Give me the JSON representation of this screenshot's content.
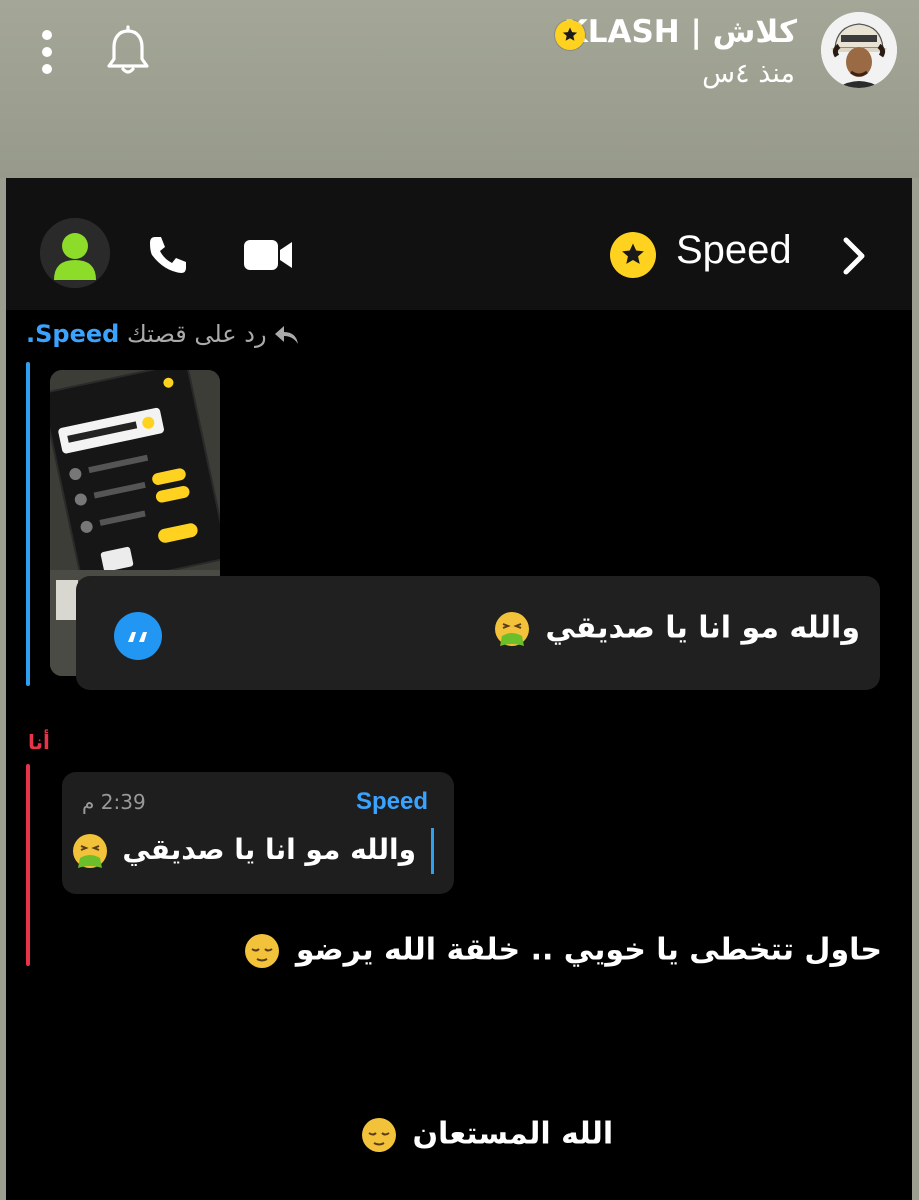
{
  "story": {
    "name": "كلاش | KLASH",
    "time": "منذ ٤س"
  },
  "chat_header": {
    "contact_name": "Speed"
  },
  "reply": {
    "prefix": "رد على قصتك",
    "name": "Speed."
  },
  "quote_card": {
    "text": "والله مو انا يا صديقي"
  },
  "me_label": "أنا",
  "quoted_reply": {
    "sender": "Speed",
    "time": "2:39 م",
    "text": "والله مو انا يا صديقي"
  },
  "messages": [
    "حاول تتخطى يا خويي .. خلقة الله يرضو",
    "الله المستعان"
  ],
  "icons": {
    "bell": "bell-icon",
    "more": "more-vertical-icon",
    "star": "star-badge-icon",
    "phone": "phone-icon",
    "video": "video-camera-icon",
    "chevron": "chevron-right-icon",
    "quote": "quote-icon",
    "reply": "reply-arrow-icon",
    "emoji_nauseated": "vomiting-face-emoji",
    "emoji_relieved": "relieved-face-emoji"
  },
  "colors": {
    "accent_blue": "#2fa0f0",
    "accent_red": "#e8334a",
    "badge_yellow": "#ffd21f",
    "chat_bg": "#000000"
  }
}
